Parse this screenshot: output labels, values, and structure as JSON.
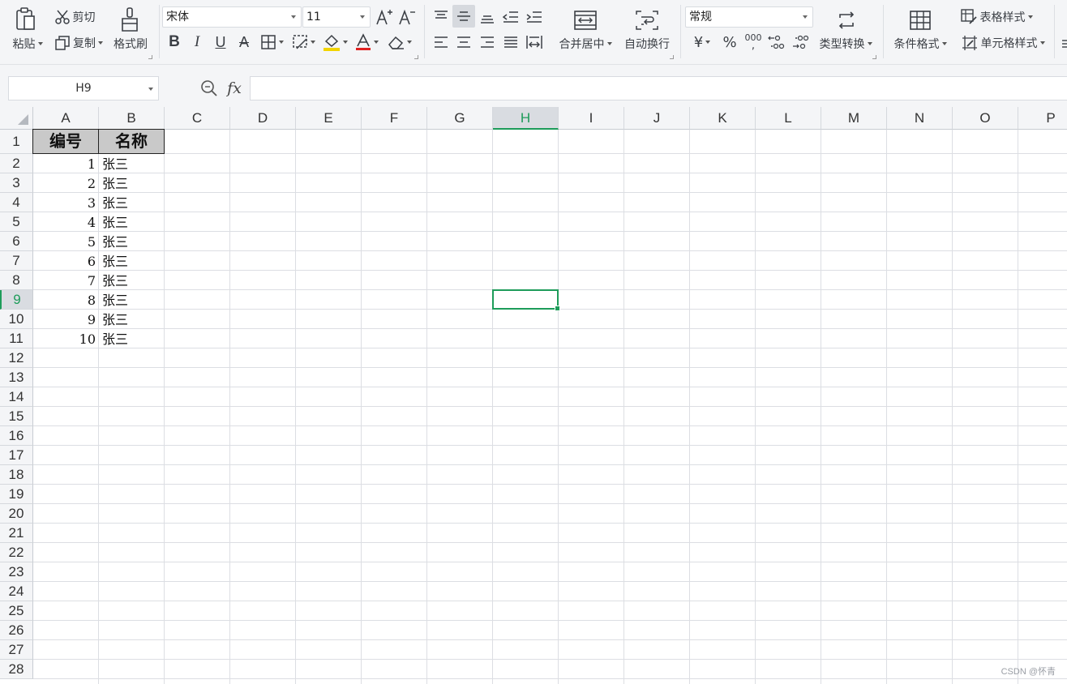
{
  "ribbon": {
    "paste": "粘贴",
    "cut": "剪切",
    "copy": "复制",
    "format_painter": "格式刷",
    "font_name": "宋体",
    "font_size": "11",
    "merge_center": "合并居中",
    "wrap_text": "自动换行",
    "number_format": "常规",
    "type_convert": "类型转换",
    "conditional_format": "条件格式",
    "table_style": "表格样式",
    "cell_style": "单元格样式",
    "currency_symbol": "¥",
    "percent_symbol": "%",
    "thousands_symbol": "000",
    "font_color": "#e02020",
    "fill_color": "#f2d400"
  },
  "formula_bar": {
    "cell_ref": "H9",
    "fx_label": "fx",
    "formula": ""
  },
  "sheet": {
    "columns": [
      "A",
      "B",
      "C",
      "D",
      "E",
      "F",
      "G",
      "H",
      "I",
      "J",
      "K",
      "L",
      "M",
      "N",
      "O",
      "P"
    ],
    "rows": [
      "1",
      "2",
      "3",
      "4",
      "5",
      "6",
      "7",
      "8",
      "9",
      "10",
      "11",
      "12",
      "13",
      "14",
      "15",
      "16",
      "17",
      "18",
      "19",
      "20",
      "21",
      "22",
      "23",
      "24",
      "25",
      "26",
      "27",
      "28"
    ],
    "active_column": "H",
    "active_row": "9",
    "header_cells": [
      "编号",
      "名称"
    ],
    "data_rows": [
      {
        "id": "1",
        "name": "张三"
      },
      {
        "id": "2",
        "name": "张三"
      },
      {
        "id": "3",
        "name": "张三"
      },
      {
        "id": "4",
        "name": "张三"
      },
      {
        "id": "5",
        "name": "张三"
      },
      {
        "id": "6",
        "name": "张三"
      },
      {
        "id": "7",
        "name": "张三"
      },
      {
        "id": "8",
        "name": "张三"
      },
      {
        "id": "9",
        "name": "张三"
      },
      {
        "id": "10",
        "name": "张三"
      }
    ],
    "selection_color": "#1e9c5a"
  },
  "watermark": "CSDN @怀青"
}
